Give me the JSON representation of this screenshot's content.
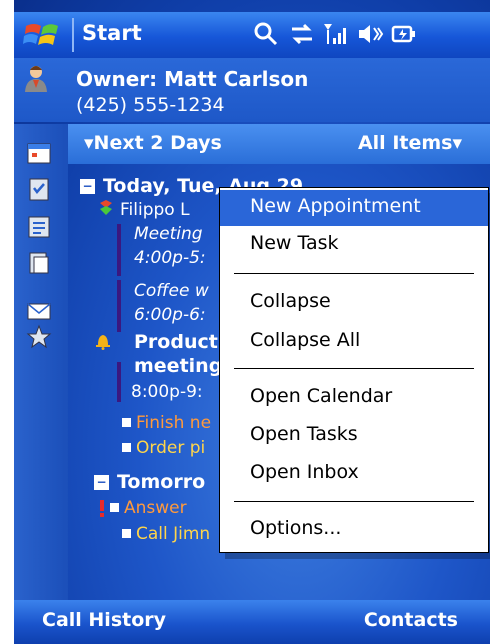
{
  "titlebar": {
    "title": "Start",
    "icons": [
      "windows-logo-icon",
      "search-icon",
      "connectivity-icon",
      "signal-icon",
      "volume-icon",
      "battery-icon"
    ]
  },
  "owner": {
    "name": "Owner: Matt Carlson",
    "phone": "(425) 555-1234"
  },
  "sidebar_icons": [
    "calendar-icon",
    "tasks-icon",
    "contacts-icon",
    "notes-icon",
    "inbox-icon",
    "favorites-icon"
  ],
  "list_header": {
    "left": "▾Next 2 Days",
    "right": "All Items▾"
  },
  "today": {
    "heading": "Today, Tue, Aug 29",
    "items": [
      {
        "text": "Filippo L",
        "style": "normal"
      },
      {
        "text": "Meeting",
        "style": "italic"
      },
      {
        "text": "4:00p-5:",
        "style": "italic"
      },
      {
        "text": "Coffee w",
        "style": "italic"
      },
      {
        "text": "6:00p-6:",
        "style": "italic"
      },
      {
        "text": "Product",
        "style": "bold"
      },
      {
        "text": "meeting",
        "style": "bold"
      },
      {
        "text": "8:00p-9:",
        "style": "normal"
      },
      {
        "text": "Finish ne",
        "style": "orange"
      },
      {
        "text": "Order pi",
        "style": "yellow"
      }
    ]
  },
  "tomorrow": {
    "heading": "Tomorro",
    "items": [
      {
        "text": "Answer",
        "style": "orange"
      },
      {
        "text": "Call Jimn",
        "style": "yellow"
      }
    ]
  },
  "context_menu": {
    "groups": [
      [
        "New Appointment",
        "New Task"
      ],
      [
        "Collapse",
        "Collapse All"
      ],
      [
        "Open Calendar",
        "Open Tasks",
        "Open Inbox"
      ],
      [
        "Options..."
      ]
    ],
    "selected": "New Appointment"
  },
  "softkeys": {
    "left": "Call History",
    "right": "Contacts"
  },
  "colors": {
    "selection": "#2a66d8",
    "task_due": "#ff9a3c",
    "task_pending": "#ffd54a"
  }
}
